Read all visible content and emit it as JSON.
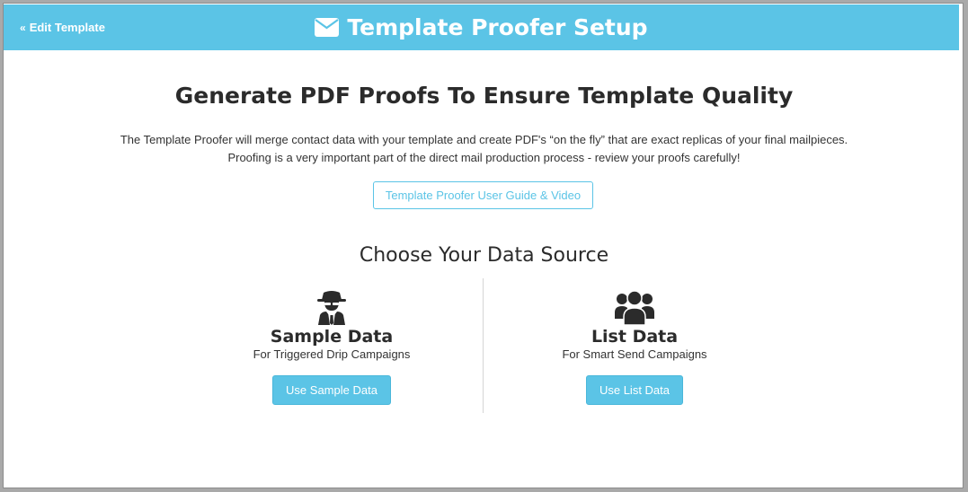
{
  "header": {
    "back_label": "Edit Template",
    "title": "Template Proofer Setup",
    "icon": "envelope-icon",
    "color": "#5bc4e6"
  },
  "main": {
    "headline": "Generate PDF Proofs To Ensure Template Quality",
    "description_line1": "The Template Proofer will merge contact data with your template and create PDF's “on the fly” that are exact replicas of your final mailpieces.",
    "description_line2": "Proofing is a very important part of the direct mail production process - review your proofs carefully!",
    "guide_button": "Template Proofer User Guide & Video",
    "subheading": "Choose Your Data Source"
  },
  "options": {
    "sample": {
      "icon": "user-secret-icon",
      "title": "Sample Data",
      "subtitle": "For Triggered Drip Campaigns",
      "button": "Use Sample Data"
    },
    "list": {
      "icon": "users-icon",
      "title": "List Data",
      "subtitle": "For Smart Send Campaigns",
      "button": "Use List Data"
    }
  }
}
